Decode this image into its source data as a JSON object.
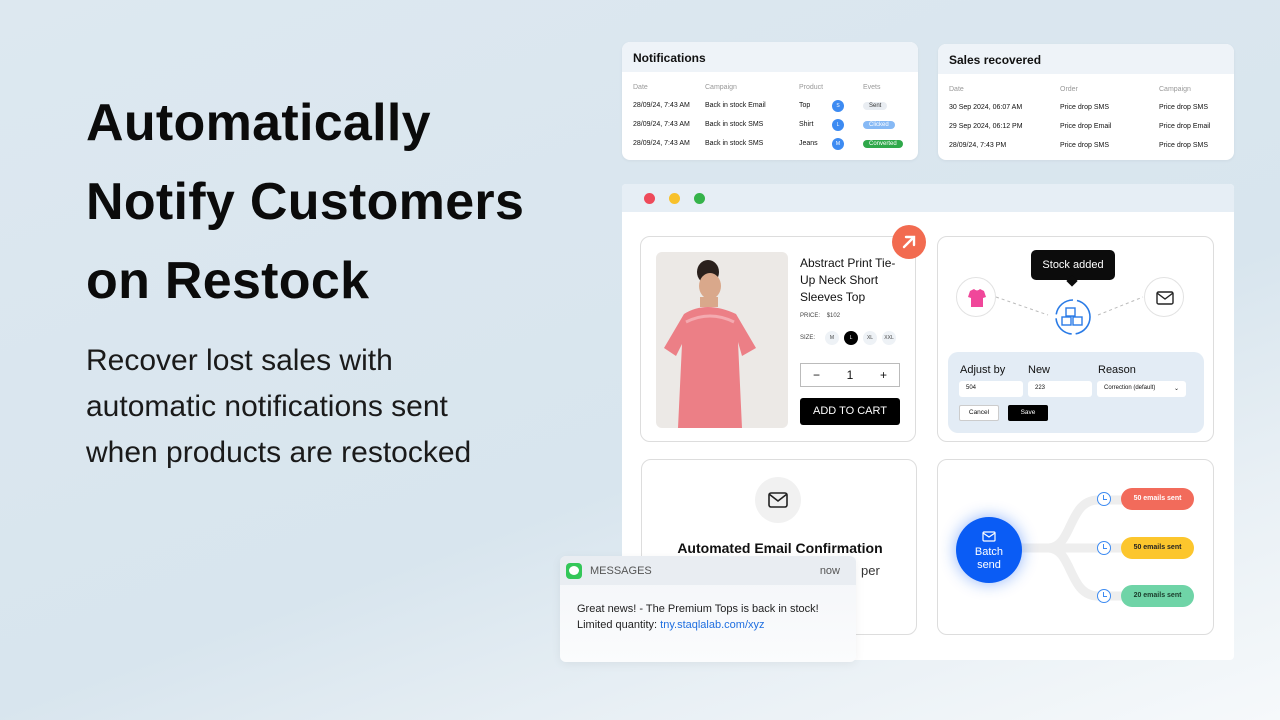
{
  "hero": {
    "title_lines": [
      "Automatically",
      "Notify Customers",
      "on Restock"
    ],
    "subtitle": "Recover lost sales with automatic notifications sent when products are restocked"
  },
  "notifications": {
    "title": "Notifications",
    "headers": [
      "Date",
      "Campaign",
      "Product",
      "Evets"
    ],
    "rows": [
      {
        "date": "28/09/24, 7:43 AM",
        "campaign": "Back in stock Email",
        "product": "Top",
        "size": "S",
        "event": "Sent",
        "event_color": "#e9edf2",
        "event_text": "#333"
      },
      {
        "date": "28/09/24, 7:43 AM",
        "campaign": "Back in stock SMS",
        "product": "Shirt",
        "size": "L",
        "event": "Clicked",
        "event_color": "#86b9f5",
        "event_text": "#fff"
      },
      {
        "date": "28/09/24, 7:43 AM",
        "campaign": "Back in stock SMS",
        "product": "Jeans",
        "size": "M",
        "event": "Converted",
        "event_color": "#2fa84a",
        "event_text": "#fff"
      }
    ]
  },
  "sales": {
    "title": "Sales recovered",
    "headers": [
      "Date",
      "Order",
      "Campaign"
    ],
    "rows": [
      {
        "date": "30 Sep 2024, 06:07 AM",
        "order": "Price drop SMS",
        "campaign": "Price drop SMS"
      },
      {
        "date": "29 Sep 2024, 06:12 PM",
        "order": "Price drop Email",
        "campaign": "Price drop Email"
      },
      {
        "date": "28/09/24, 7:43 PM",
        "order": "Price drop SMS",
        "campaign": "Price drop SMS"
      }
    ]
  },
  "product": {
    "name": "Abstract Print Tie-Up Neck Short Sleeves Top",
    "price_label": "PRICE:",
    "price": "$102",
    "size_label": "SIZE:",
    "sizes": [
      "M",
      "L",
      "XL",
      "XXL"
    ],
    "selected_size": "L",
    "qty": "1",
    "minus": "−",
    "plus": "+",
    "add_to_cart": "ADD TO CART"
  },
  "stock": {
    "tooltip": "Stock added",
    "adjust_label": "Adjust by",
    "new_label": "New",
    "reason_label": "Reason",
    "adjust_value": "504",
    "new_value": "223",
    "reason_value": "Correction (default)",
    "cancel": "Cancel",
    "save": "Save"
  },
  "email": {
    "title": "Automated Email Confirmation",
    "partial": "per"
  },
  "batch": {
    "label": "Batch send",
    "pills": [
      {
        "text": "50 emails sent",
        "color": "#f26b5b",
        "text_color": "#fff"
      },
      {
        "text": "50 emails sent",
        "color": "#fcc62d",
        "text_color": "#222"
      },
      {
        "text": "20 emails sent",
        "color": "#6fd4a7",
        "text_color": "#1a3a2a"
      }
    ]
  },
  "message": {
    "app": "MESSAGES",
    "time": "now",
    "text": "Great news! - The Premium Tops is back in stock!",
    "link_prefix": "Limited quantity: ",
    "link": "tny.staqlalab.com/xyz"
  },
  "colors": {
    "accent_blue": "#0a5cf5",
    "arrow_orange": "#f26b50"
  }
}
